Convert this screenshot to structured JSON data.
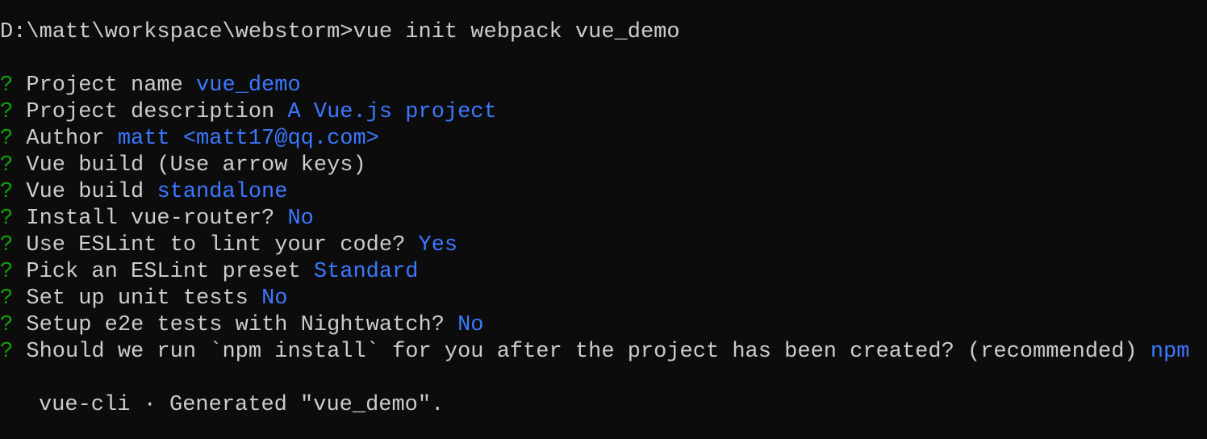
{
  "colors": {
    "background": "#0c0c0c",
    "text": "#cccccc",
    "prompt_marker": "#13a10e",
    "answer": "#3b78ff"
  },
  "command_line": {
    "prompt": "D:\\matt\\workspace\\webstorm>",
    "command": "vue init webpack vue_demo"
  },
  "questions": [
    {
      "marker": "?",
      "text": "Project name",
      "answer": "vue_demo"
    },
    {
      "marker": "?",
      "text": "Project description",
      "answer": "A Vue.js project"
    },
    {
      "marker": "?",
      "text": "Author",
      "answer": "matt <matt17@qq.com>"
    },
    {
      "marker": "?",
      "text": "Vue build (Use arrow keys)",
      "answer": ""
    },
    {
      "marker": "?",
      "text": "Vue build",
      "answer": "standalone"
    },
    {
      "marker": "?",
      "text": "Install vue-router?",
      "answer": "No"
    },
    {
      "marker": "?",
      "text": "Use ESLint to lint your code?",
      "answer": "Yes"
    },
    {
      "marker": "?",
      "text": "Pick an ESLint preset",
      "answer": "Standard"
    },
    {
      "marker": "?",
      "text": "Set up unit tests",
      "answer": "No"
    },
    {
      "marker": "?",
      "text": "Setup e2e tests with Nightwatch?",
      "answer": "No"
    },
    {
      "marker": "?",
      "text": "Should we run `npm install` for you after the project has been created? (recommended)",
      "answer": "npm"
    }
  ],
  "footer": {
    "text": "vue-cli · Generated \"vue_demo\"."
  }
}
